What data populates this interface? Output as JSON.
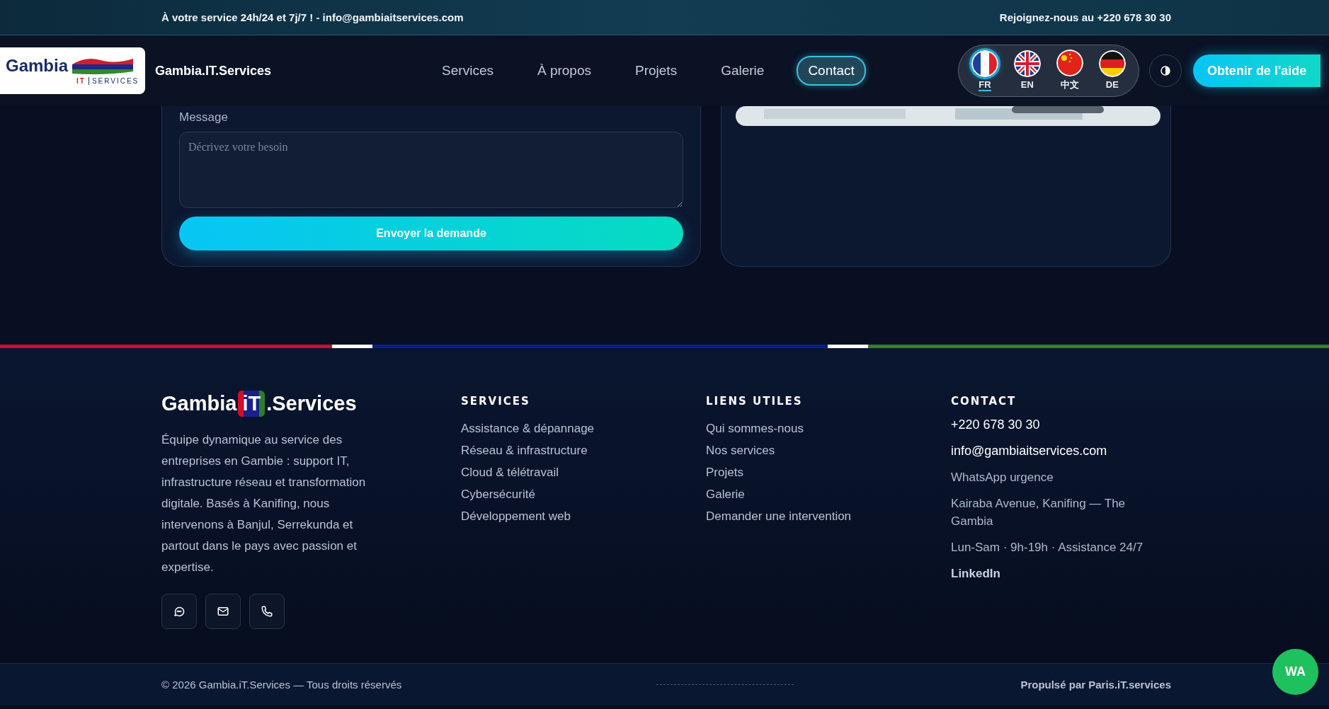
{
  "top_bar": {
    "left": "À votre service 24h/24 et 7j/7 ! - info@gambiaitservices.com",
    "right": "Rejoignez-nous au +220 678 30 30"
  },
  "header": {
    "logo": {
      "word": "Gambia",
      "tag": "IT",
      "sub": "SERVICES"
    },
    "brand": "Gambia.IT.Services",
    "nav": [
      {
        "label": "Services",
        "selected": false
      },
      {
        "label": "À propos",
        "selected": false
      },
      {
        "label": "Projets",
        "selected": false
      },
      {
        "label": "Galerie",
        "selected": false
      },
      {
        "label": "Contact",
        "selected": true
      }
    ],
    "languages": [
      {
        "code": "FR",
        "kind": "fr",
        "selected": true
      },
      {
        "code": "EN",
        "kind": "gb",
        "selected": false
      },
      {
        "code": "中文",
        "kind": "cn",
        "selected": false
      },
      {
        "code": "DE",
        "kind": "de",
        "selected": false
      }
    ],
    "help_button": "Obtenir de l'aide"
  },
  "form": {
    "message_label": "Message",
    "message_placeholder": "Décrivez votre besoin",
    "submit": "Envoyer la demande"
  },
  "footer": {
    "brand": {
      "before": "Gambia",
      "badge": "iT",
      "after": ".Services"
    },
    "description": "Équipe dynamique au service des entreprises en Gambie : support IT, infrastructure réseau et transformation digitale. Basés à Kanifing, nous intervenons à Banjul, Serrekunda et partout dans le pays avec passion et expertise.",
    "social": [
      {
        "kind": "chat"
      },
      {
        "kind": "mail"
      },
      {
        "kind": "phone"
      }
    ],
    "columns": [
      {
        "title": "SERVICES",
        "links": [
          "Assistance & dépannage",
          "Réseau & infrastructure",
          "Cloud & télétravail",
          "Cybersécurité",
          "Développement web"
        ]
      },
      {
        "title": "LIENS UTILES",
        "links": [
          "Qui sommes-nous",
          "Nos services",
          "Projets",
          "Galerie",
          "Demander une intervention"
        ]
      }
    ],
    "contact": {
      "title": "CONTACT",
      "items": [
        {
          "kind": "strong",
          "text": "+220 678 30 30"
        },
        {
          "kind": "strong",
          "text": "info@gambiaitservices.com"
        },
        {
          "kind": "plain",
          "text": "WhatsApp urgence"
        },
        {
          "kind": "plain",
          "text": "Kairaba Avenue, Kanifing — The Gambia"
        },
        {
          "kind": "plain",
          "text": "Lun-Sam · 9h-19h · Assistance 24/7"
        },
        {
          "kind": "bold",
          "text": "LinkedIn"
        }
      ]
    }
  },
  "bottom_bar": {
    "copyright": "© 2026 Gambia.iT.Services — Tous droits réservés",
    "powered": "Propulsé par Paris.iT.services"
  },
  "whatsapp_button": "WA"
}
